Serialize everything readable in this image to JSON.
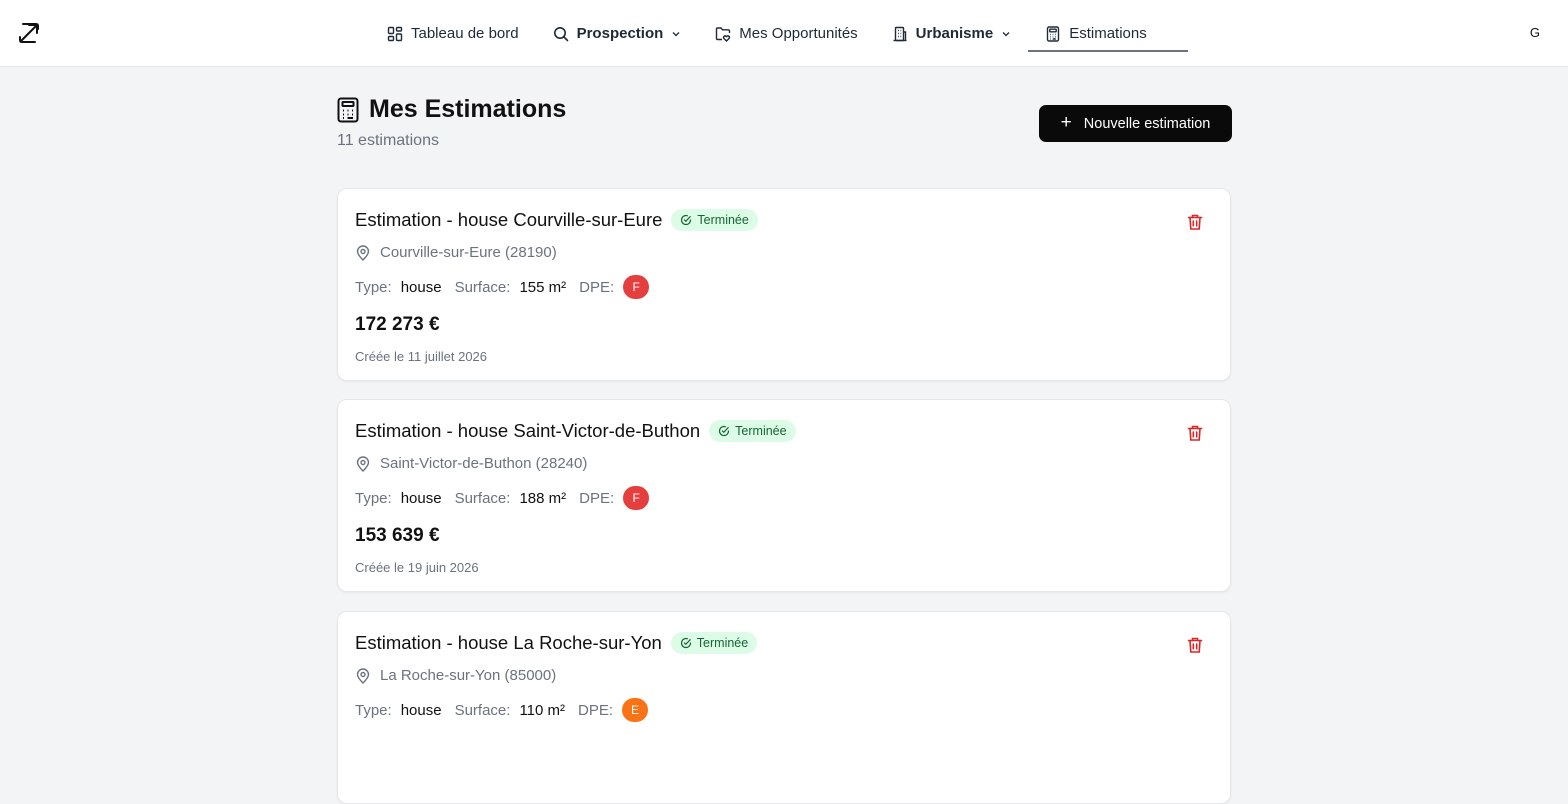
{
  "nav": {
    "items": [
      {
        "label": "Tableau de bord",
        "icon": "dashboard-icon"
      },
      {
        "label": "Prospection",
        "icon": "search-icon"
      },
      {
        "label": "Mes Opportunités",
        "icon": "folder-heart-icon"
      },
      {
        "label": "Urbanisme",
        "icon": "building-icon"
      },
      {
        "label": "Estimations",
        "icon": "calculator-icon"
      }
    ],
    "user_initial": "G"
  },
  "header": {
    "title": "Mes Estimations",
    "count": "11 estimations",
    "new_button_label": "Nouvelle estimation"
  },
  "labels": {
    "type": "Type:",
    "surface": "Surface:",
    "dpe": "DPE:"
  },
  "colors": {
    "dpe_f": "#e53e3e",
    "dpe_e": "#f97316",
    "badge_bg": "#dcfce7",
    "badge_text": "#166534"
  },
  "estimations": [
    {
      "title": "Estimation - house Courville-sur-Eure",
      "status": "Terminée",
      "location": "Courville-sur-Eure (28190)",
      "type": "house",
      "surface": "155 m²",
      "dpe": "F",
      "price": "172 273 €",
      "created": "Créée le 11 juillet 2026"
    },
    {
      "title": "Estimation - house Saint-Victor-de-Buthon",
      "status": "Terminée",
      "location": "Saint-Victor-de-Buthon (28240)",
      "type": "house",
      "surface": "188 m²",
      "dpe": "F",
      "price": "153 639 €",
      "created": "Créée le 19 juin 2026"
    },
    {
      "title": "Estimation - house La Roche-sur-Yon",
      "status": "Terminée",
      "location": "La Roche-sur-Yon (85000)",
      "type": "house",
      "surface": "110 m²",
      "dpe": "E",
      "price": "",
      "created": ""
    }
  ]
}
